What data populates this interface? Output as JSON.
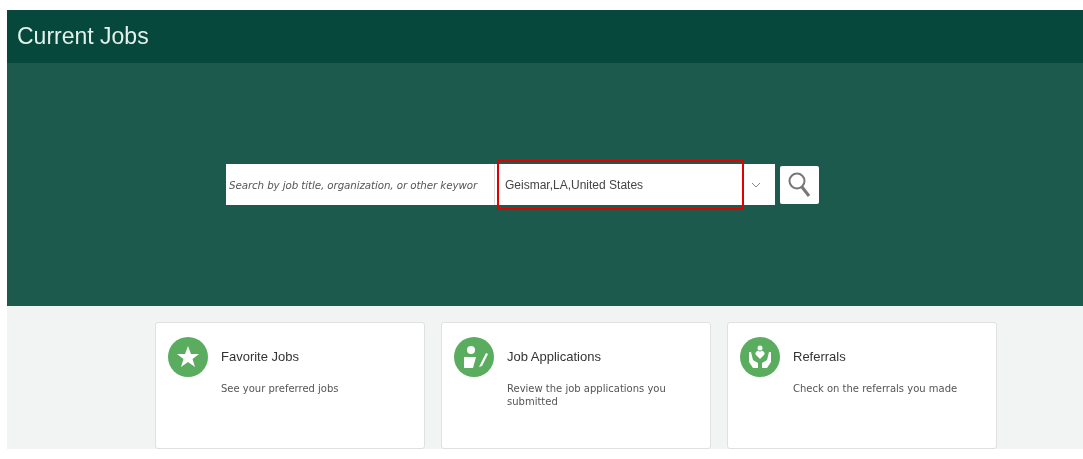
{
  "header": {
    "title": "Current Jobs"
  },
  "search": {
    "keyword_placeholder": "Search by job title, organization, or other keywor",
    "location_value": "Geismar,LA,United States",
    "location_highlighted": true
  },
  "cards": [
    {
      "kind": "star",
      "title": "Favorite Jobs",
      "description": "See your preferred jobs"
    },
    {
      "kind": "application",
      "title": "Job Applications",
      "description": "Review the job applications you submitted"
    },
    {
      "kind": "referral",
      "title": "Referrals",
      "description": "Check on the referrals you made"
    }
  ]
}
